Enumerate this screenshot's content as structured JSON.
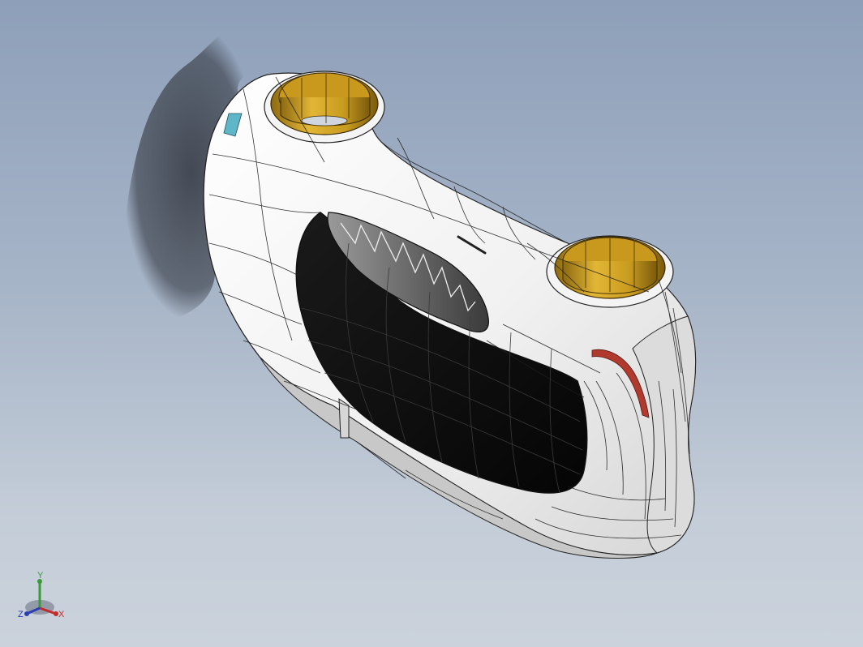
{
  "viewport": {
    "background_top": "#8e9fb9",
    "background_bottom": "#cbd2dc",
    "model": {
      "body_color": "#f4f4f4",
      "window_color": "#0b0b0b",
      "bushing_color": "#c79a1f",
      "accent_red": "#b03a2e",
      "accent_blue": "#5fb6c9",
      "shadow_color": "#3a3f48"
    }
  },
  "triad": {
    "y_label": "Y",
    "z_label": "Z",
    "x_label": "X",
    "y_color": "#3a9a3a",
    "z_color": "#2b3fb5",
    "x_color": "#c42b2b"
  }
}
